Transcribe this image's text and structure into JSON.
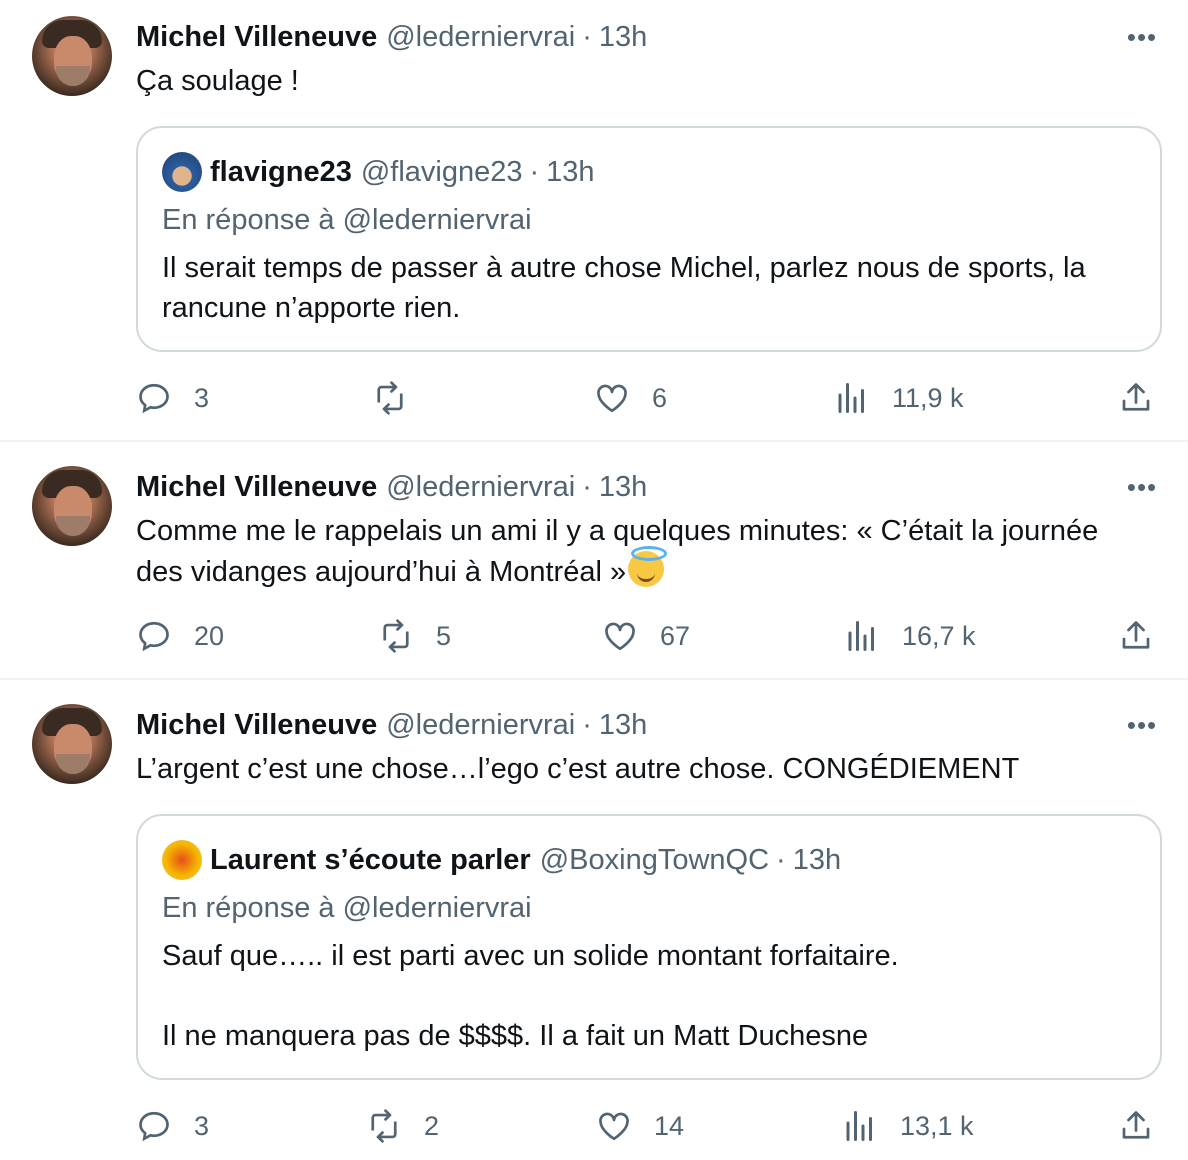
{
  "tweets": [
    {
      "author_name": "Michel Villeneuve",
      "author_handle": "@ledernierv​rai",
      "separator": "·",
      "time": "13h",
      "more": "•••",
      "text": "Ça soulage !",
      "quote": {
        "author_name": "flavigne23",
        "author_handle": "@flavigne23",
        "separator": "·",
        "time": "13h",
        "reply_to": "En réponse à @ledernierv​rai",
        "text_lines": [
          "Il serait temps de passer à autre chose Michel, parlez nous de sports, la",
          "rancune n’apporte rien."
        ]
      },
      "actions": {
        "replies": "3",
        "retweets": "",
        "likes": "6",
        "views": "11,9 k"
      }
    },
    {
      "author_name": "Michel Villeneuve",
      "author_handle": "@ledernierv​rai",
      "separator": "·",
      "time": "13h",
      "more": "•••",
      "text_lines": [
        "Comme me le rappelais un ami il y a quelques minutes:  « C’était la journée",
        "des vidanges aujourd’hui à Montréal »"
      ],
      "actions": {
        "replies": "20",
        "retweets": "5",
        "likes": "67",
        "views": "16,7 k"
      }
    },
    {
      "author_name": "Michel Villeneuve",
      "author_handle": "@ledernierv​rai",
      "separator": "·",
      "time": "13h",
      "more": "•••",
      "text": "L’argent c’est une chose…l’ego c’est autre chose.  CONGÉDIEMENT",
      "quote": {
        "author_name": "Laurent s’écoute parler",
        "author_handle": "@BoxingTownQC",
        "separator": "·",
        "time": "13h",
        "reply_to": "En réponse à @ledernierv​rai",
        "text_lines": [
          "Sauf que….. il est parti avec un solide montant forfaitaire.",
          "Il ne manquera pas de $$$$. Il a fait un Matt Duchesne"
        ]
      },
      "actions": {
        "replies": "3",
        "retweets": "2",
        "likes": "14",
        "views": "13,1 k"
      }
    }
  ],
  "icons": [
    "reply-icon",
    "retweet-icon",
    "like-icon",
    "views-icon",
    "share-icon",
    "more-icon",
    "smiling-face-with-halo-emoji"
  ],
  "colors": {
    "text": "#0f1419",
    "secondary": "#536471",
    "border": "#cfd9de",
    "divider": "#eff3f4"
  }
}
